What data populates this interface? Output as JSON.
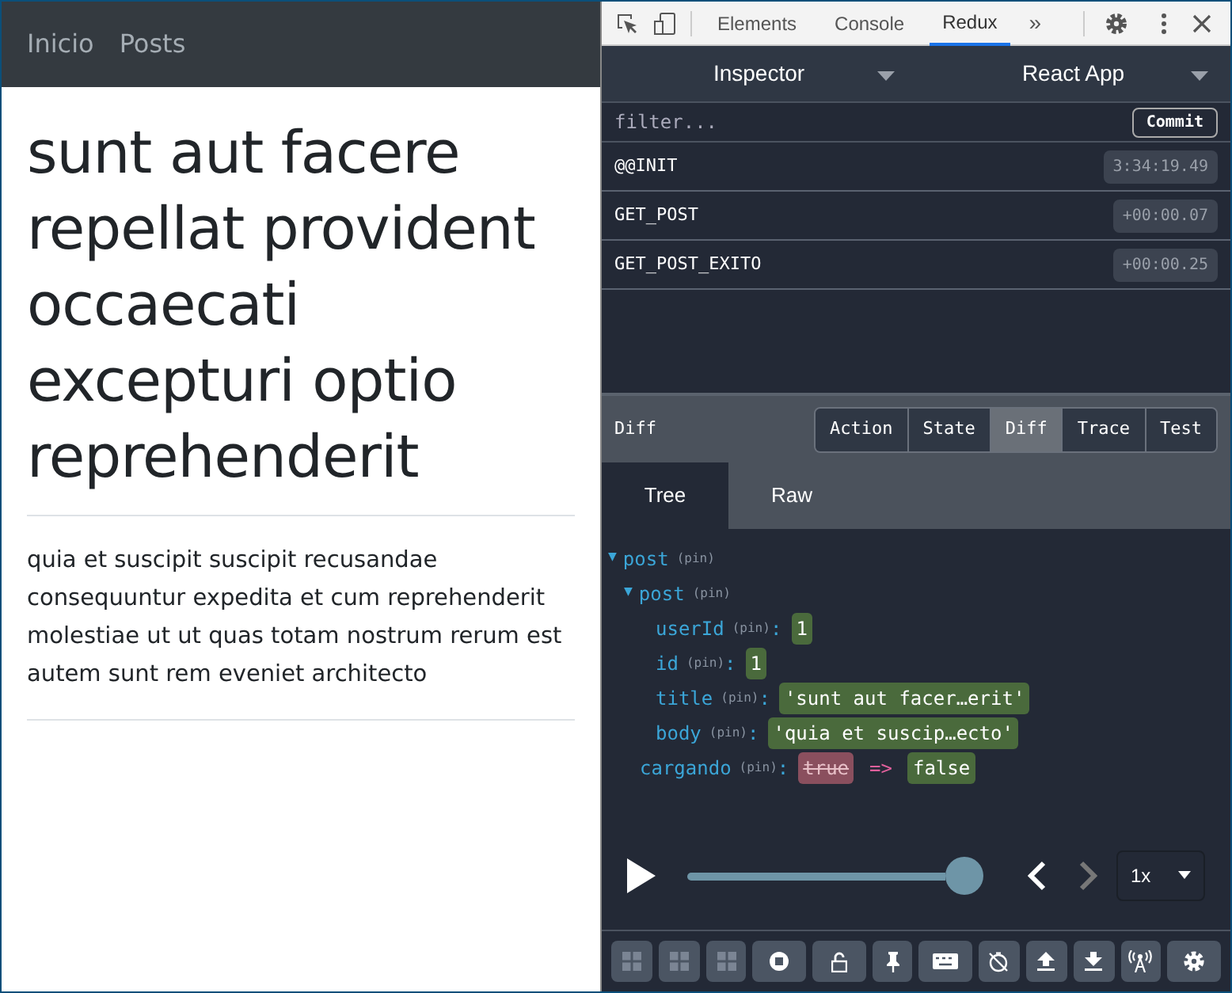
{
  "navbar": {
    "links": [
      {
        "label": "Inicio"
      },
      {
        "label": "Posts"
      }
    ]
  },
  "article": {
    "title": "sunt aut facere repellat provident occaecati excepturi optio reprehenderit",
    "body": "quia et suscipit suscipit recusandae consequuntur expedita et cum reprehenderit molestiae ut ut quas totam nostrum rerum est autem sunt rem eveniet architecto"
  },
  "devtools": {
    "tabs": [
      {
        "label": "Elements",
        "selected": false
      },
      {
        "label": "Console",
        "selected": false
      },
      {
        "label": "Redux",
        "selected": true
      }
    ],
    "more": "»"
  },
  "redux": {
    "monitor": "Inspector",
    "instance": "React App",
    "filter": {
      "placeholder": "filter..."
    },
    "commit": "Commit",
    "actions": [
      {
        "name": "@@INIT",
        "time": "3:34:19.49"
      },
      {
        "name": "GET_POST",
        "time": "+00:00.07"
      },
      {
        "name": "GET_POST_EXITO",
        "time": "+00:00.25"
      }
    ],
    "detail_title": "Diff",
    "detail_tabs": [
      {
        "label": "Action",
        "selected": false
      },
      {
        "label": "State",
        "selected": false
      },
      {
        "label": "Diff",
        "selected": true
      },
      {
        "label": "Trace",
        "selected": false
      },
      {
        "label": "Test",
        "selected": false
      }
    ],
    "view_tabs": [
      {
        "label": "Tree",
        "selected": true
      },
      {
        "label": "Raw",
        "selected": false
      }
    ],
    "tree": [
      {
        "kind": "object",
        "toggle": "▼",
        "key": "post",
        "pin": "(pin)",
        "children": [
          {
            "kind": "object",
            "toggle": "▼",
            "key": "post",
            "pin": "(pin)",
            "children": [
              {
                "kind": "value",
                "key": "userId",
                "pin": "(pin)",
                "colon": ":",
                "value": "1"
              },
              {
                "kind": "value",
                "key": "id",
                "pin": "(pin)",
                "colon": ":",
                "value": "1"
              },
              {
                "kind": "value",
                "key": "title",
                "pin": "(pin)",
                "colon": ":",
                "value": "'sunt aut facer…erit'"
              },
              {
                "kind": "value",
                "key": "body",
                "pin": "(pin)",
                "colon": ":",
                "value": "'quia et suscip…ecto'"
              }
            ]
          },
          {
            "kind": "changed",
            "key": "cargando",
            "pin": "(pin)",
            "colon": ":",
            "old": "true",
            "arrow": "=>",
            "value": "false"
          }
        ]
      }
    ],
    "slider": {
      "level": 1.0
    },
    "prev_disabled": false,
    "next_disabled": true,
    "speed": "1x",
    "toolbar": [
      {
        "kind": "dock",
        "disabled": true
      },
      {
        "kind": "dock",
        "disabled": true
      },
      {
        "kind": "dock",
        "disabled": true
      },
      {
        "kind": "record",
        "disabled": false
      },
      {
        "kind": "lock",
        "disabled": false
      },
      {
        "kind": "pin",
        "disabled": false
      },
      {
        "kind": "keyboard",
        "disabled": false
      },
      {
        "kind": "timer",
        "disabled": false
      },
      {
        "kind": "upload",
        "disabled": false
      },
      {
        "kind": "download",
        "disabled": false
      },
      {
        "kind": "remote",
        "disabled": false
      },
      {
        "kind": "settings",
        "disabled": false
      }
    ]
  }
}
